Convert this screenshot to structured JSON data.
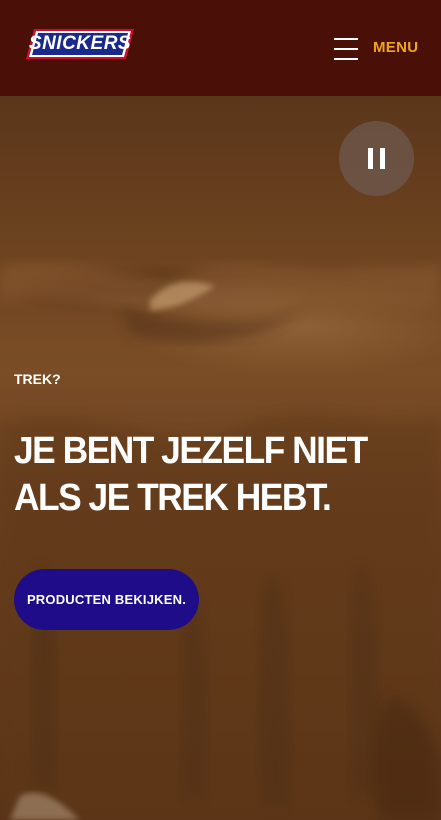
{
  "header": {
    "logo_text": "SNICKERS",
    "menu_label": "MENU"
  },
  "hero": {
    "eyebrow": "TREK?",
    "headline": "JE BENT JEZELF NIET ALS JE TREK HEBT.",
    "cta_label": "PRODUCTEN BEKIJKEN."
  },
  "colors": {
    "header_bg": "#4a0f06",
    "menu_accent": "#f0a51f",
    "cta_bg": "#1f0c88",
    "logo_red": "#c8102e",
    "logo_blue": "#1a2a8c"
  },
  "icons": {
    "menu": "hamburger-icon",
    "pause": "pause-icon"
  }
}
